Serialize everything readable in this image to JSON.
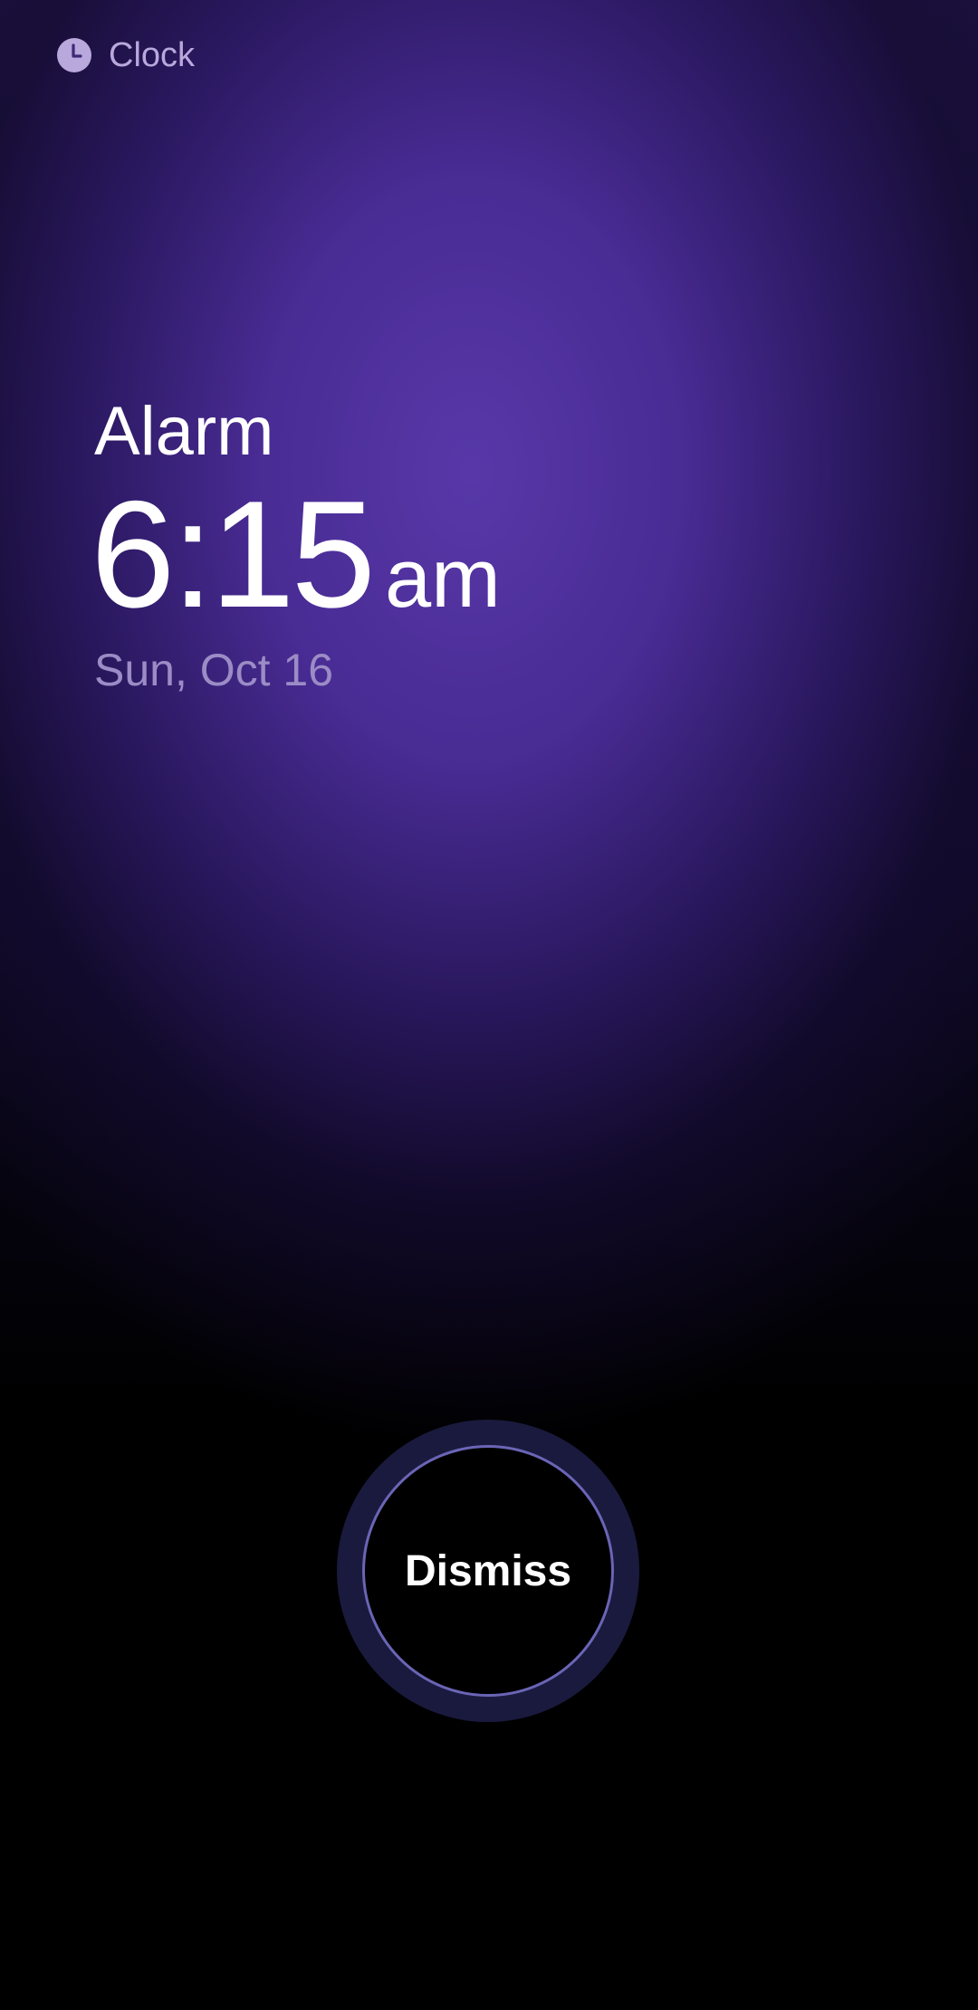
{
  "header": {
    "app_name": "Clock",
    "icon": "clock-icon"
  },
  "alarm": {
    "label": "Alarm",
    "time": "6:15",
    "ampm": "am",
    "date": "Sun, Oct 16"
  },
  "dismiss": {
    "label": "Dismiss"
  },
  "colors": {
    "background_accent": "#5838a8",
    "header_text": "#b9a8dc",
    "date_text": "#9b8cc6",
    "dismiss_ring": "#6a65b6",
    "dismiss_halo": "#1a1a3e"
  }
}
